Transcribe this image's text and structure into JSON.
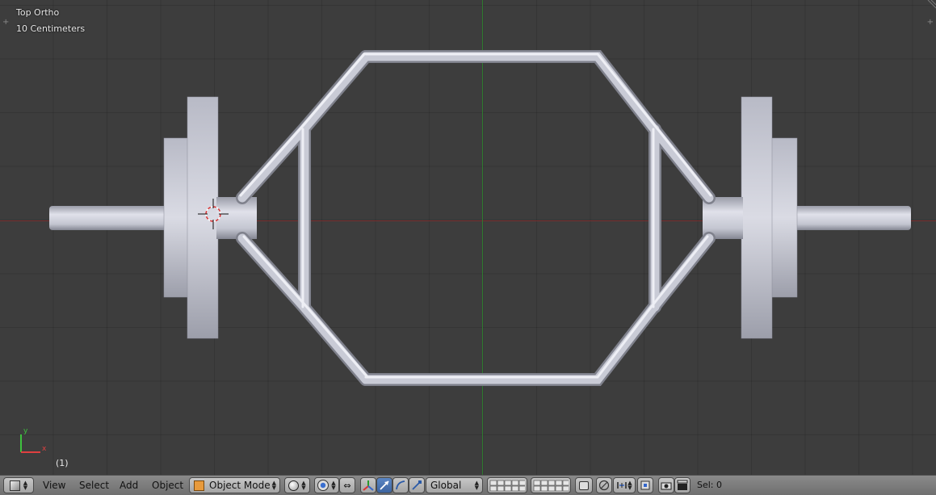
{
  "viewport": {
    "view_name": "Top Ortho",
    "scale_label": "10 Centimeters",
    "frame": "(1)",
    "axis_labels": {
      "x": "x",
      "y": "y"
    }
  },
  "header": {
    "menus": [
      "View",
      "Select",
      "Add",
      "Object"
    ],
    "mode": "Object Mode",
    "orientation": "Global",
    "selection": "Sel: 0"
  },
  "colors": {
    "background": "#3d3d3d",
    "x_axis": "#7a2f2f",
    "y_axis": "#2f7a2f",
    "header": "#7d7d7d",
    "metal": "#c4c6d2"
  },
  "icons": [
    "viewport-type-icon",
    "shading-solid-icon",
    "pivot-icon",
    "manipulator-icon",
    "translate-icon",
    "rotate-icon",
    "scale-icon",
    "layers-icon",
    "lock-icon",
    "proportional-edit-icon",
    "snap-icon",
    "snap-target-icon",
    "render-icon",
    "clapper-icon"
  ]
}
